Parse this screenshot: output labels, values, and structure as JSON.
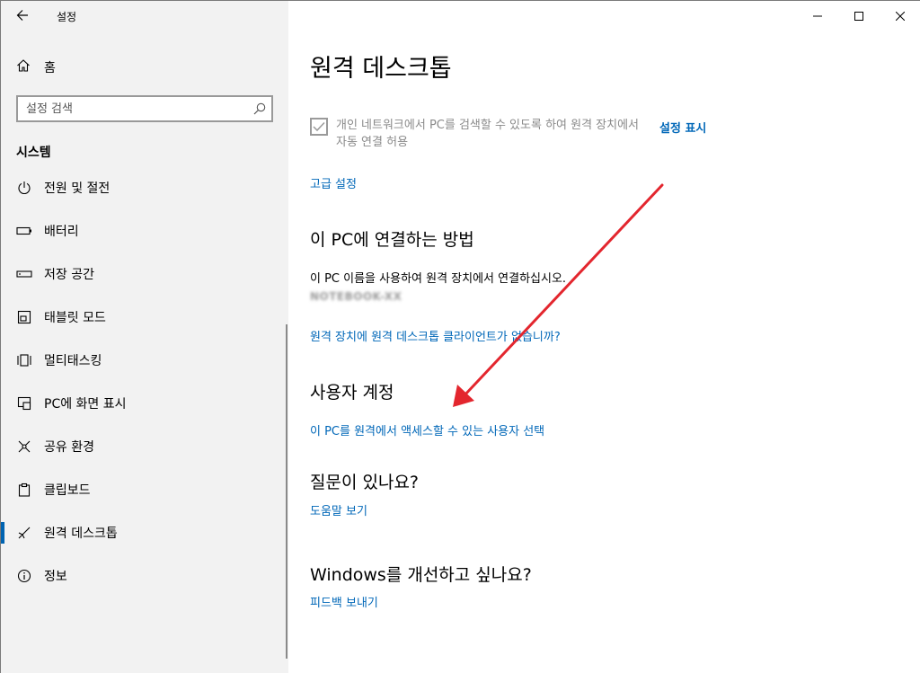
{
  "window": {
    "title": "설정"
  },
  "sidebar": {
    "home_label": "홈",
    "search": {
      "placeholder": "설정 검색"
    },
    "section_title": "시스템",
    "items": [
      {
        "label": "전원 및 절전",
        "icon": "power-icon"
      },
      {
        "label": "배터리",
        "icon": "battery-icon"
      },
      {
        "label": "저장 공간",
        "icon": "storage-icon"
      },
      {
        "label": "태블릿 모드",
        "icon": "tablet-icon"
      },
      {
        "label": "멀티태스킹",
        "icon": "multitasking-icon"
      },
      {
        "label": "PC에 화면 표시",
        "icon": "project-icon"
      },
      {
        "label": "공유 환경",
        "icon": "shared-experiences-icon"
      },
      {
        "label": "클립보드",
        "icon": "clipboard-icon"
      },
      {
        "label": "원격 데스크톱",
        "icon": "remote-desktop-icon",
        "active": true
      },
      {
        "label": "정보",
        "icon": "info-icon"
      }
    ]
  },
  "main": {
    "title": "원격 데스크톱",
    "checkbox": {
      "label": "개인 네트워크에서 PC를 검색할 수 있도록 하여 원격 장치에서 자동 연결 허용",
      "checked": true
    },
    "show_settings_link": "설정 표시",
    "advanced_settings_link": "고급 설정",
    "connect_section": {
      "heading": "이 PC에 연결하는 방법",
      "instruction": "이 PC 이름을 사용하여 원격 장치에서 연결하십시오.",
      "pc_name": "NOTEBOOK-XX",
      "client_link": "원격 장치에 원격 데스크톱 클라이언트가 없습니까?"
    },
    "user_accounts": {
      "heading": "사용자 계정",
      "select_users_link": "이 PC를 원격에서 액세스할 수 있는 사용자 선택"
    },
    "questions": {
      "heading": "질문이 있나요?",
      "help_link": "도움말 보기"
    },
    "improve": {
      "heading": "Windows를 개선하고 싶나요?",
      "feedback_link": "피드백 보내기"
    }
  },
  "annotation": {
    "arrow_color": "#e3262e"
  },
  "colors": {
    "accent": "#0067b8",
    "sidebar_bg": "#f2f2f2"
  }
}
